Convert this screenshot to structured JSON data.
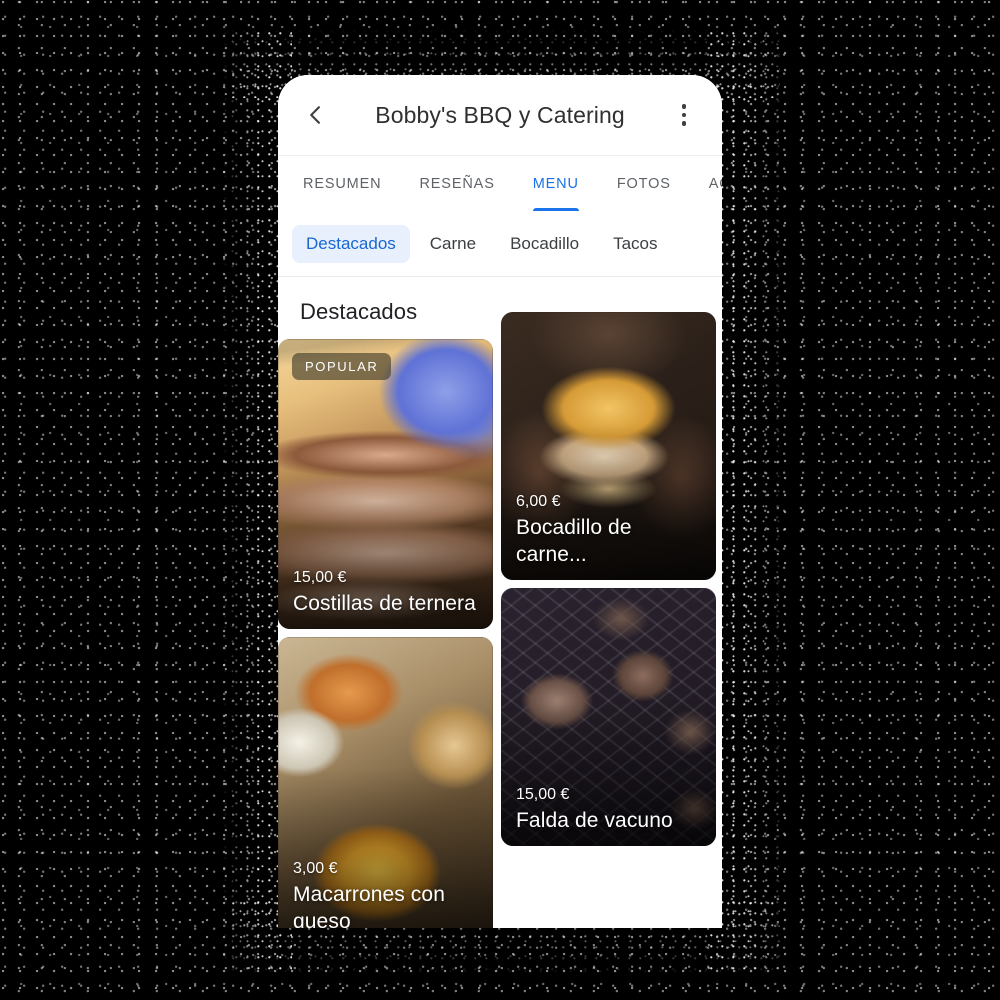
{
  "appbar": {
    "back_icon": "chevron-left-icon",
    "title": "Bobby's BBQ y Catering",
    "overflow_icon": "more-vert-icon"
  },
  "tabs": [
    {
      "label": "RESUMEN",
      "active": false
    },
    {
      "label": "RESEÑAS",
      "active": false
    },
    {
      "label": "MENU",
      "active": true
    },
    {
      "label": "FOTOS",
      "active": false
    },
    {
      "label": "ACERCA DE",
      "active": false
    }
  ],
  "chips": [
    {
      "label": "Destacados",
      "selected": true
    },
    {
      "label": "Carne",
      "selected": false
    },
    {
      "label": "Bocadillo",
      "selected": false
    },
    {
      "label": "Tacos",
      "selected": false
    }
  ],
  "section": {
    "title": "Destacados"
  },
  "items": [
    {
      "name": "Costillas de ternera",
      "price": "15,00 €",
      "badge": "POPULAR",
      "photo": "sliced-beef-ribs-photo"
    },
    {
      "name": "Bocadillo de carne...",
      "price": "6,00 €",
      "badge": "",
      "photo": "pulled-pork-sandwich-photo"
    },
    {
      "name": "Macarrones con queso",
      "price": "3,00 €",
      "badge": "",
      "photo": "mac-and-cheese-photo"
    },
    {
      "name": "Falda de vacuno",
      "price": "15,00 €",
      "badge": "",
      "photo": "smoked-brisket-on-grill-photo"
    }
  ],
  "colors": {
    "accent": "#1a73e8",
    "chip_selected_bg": "#e8f0fe",
    "chip_selected_text": "#1967d2",
    "tab_inactive": "#5f6368",
    "title": "#202124",
    "badge_bg": "rgba(60,56,40,0.62)",
    "surface": "#ffffff",
    "backdrop": "#000000"
  }
}
